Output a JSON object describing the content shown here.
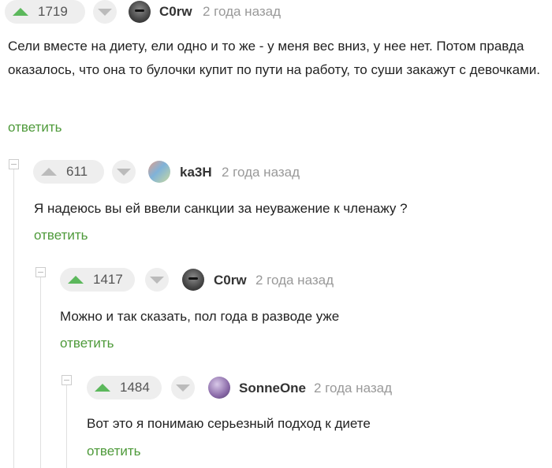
{
  "comments": [
    {
      "rating": "1719",
      "username": "C0rw",
      "time": "2 года назад",
      "text": "Сели вместе на диету, ели одно и то же - у меня вес вниз, у нее нет. Потом правда оказалось, что она то булочки купит по пути на работу, то суши закажут с девочками.",
      "reply": "ответить"
    },
    {
      "rating": "611",
      "username": "ka3H",
      "time": "2 года назад",
      "text": "Я надеюсь вы ей ввели санкции за неуважение к членажу ?",
      "reply": "ответить"
    },
    {
      "rating": "1417",
      "username": "C0rw",
      "time": "2 года назад",
      "text": "Можно и так сказать, пол года в разводе уже",
      "reply": "ответить"
    },
    {
      "rating": "1484",
      "username": "SonneOne",
      "time": "2 года назад",
      "text": "Вот это я понимаю серьезный подход к диете",
      "reply": "ответить"
    }
  ],
  "colors": {
    "upvote": "#5cb85c",
    "reply_link": "#4e9a3a",
    "muted": "#999999"
  }
}
